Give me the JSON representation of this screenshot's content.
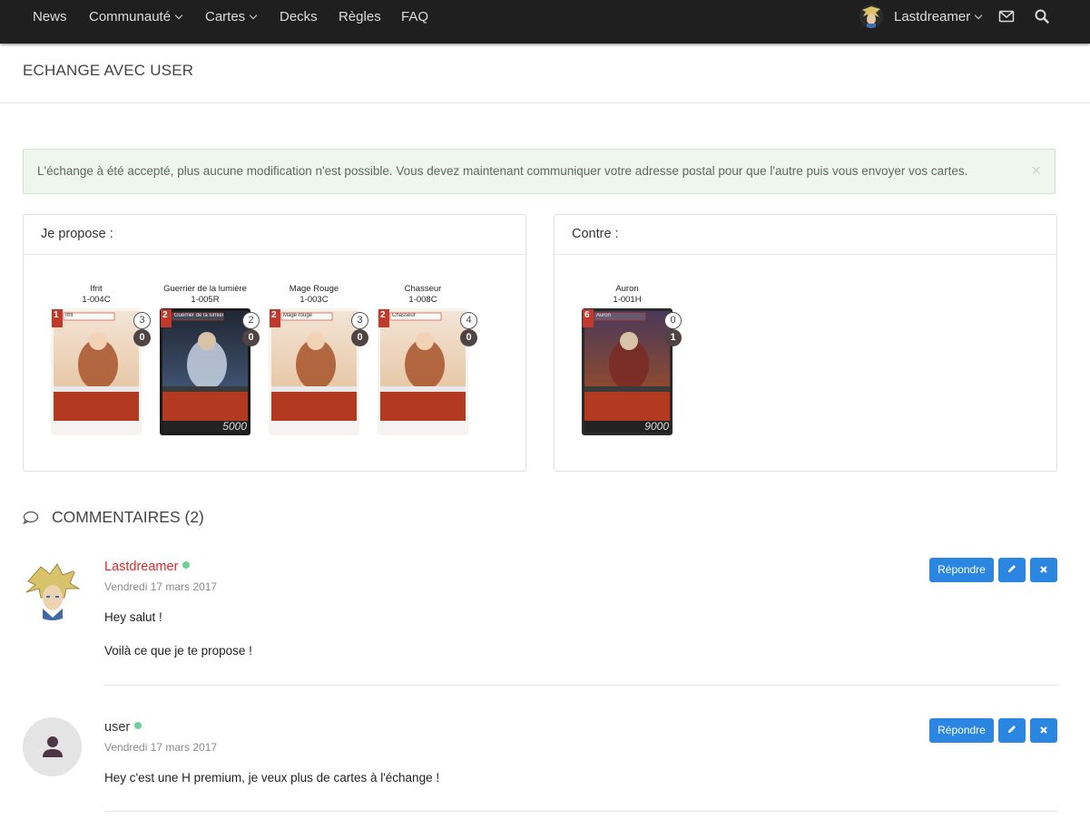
{
  "nav": {
    "items": [
      {
        "label": "News"
      },
      {
        "label": "Communauté"
      },
      {
        "label": "Cartes"
      },
      {
        "label": "Decks"
      },
      {
        "label": "Règles"
      },
      {
        "label": "FAQ"
      }
    ],
    "username": "Lastdreamer"
  },
  "page": {
    "title": "ECHANGE AVEC USER"
  },
  "alert": {
    "text": "L'échange à été accepté, plus aucune modification n'est possible. Vous devez maintenant communiquer votre adresse postal pour que l'autre puis vous envoyer vos cartes.",
    "close": "×"
  },
  "propose": {
    "title": "Je propose :",
    "cards": [
      {
        "name": "Ifrit",
        "code": "1-004C",
        "count": "3",
        "trade": "0",
        "cost": "1",
        "title_on_card": "Ifrit",
        "style": "light",
        "power": ""
      },
      {
        "name": "Guerrier de la lumière",
        "code": "1-005R",
        "count": "2",
        "trade": "0",
        "cost": "2",
        "title_on_card": "Guerrier de la lumière",
        "style": "dark",
        "power": "5000"
      },
      {
        "name": "Mage Rouge",
        "code": "1-003C",
        "count": "3",
        "trade": "0",
        "cost": "2",
        "title_on_card": "Mage rouge",
        "style": "light",
        "power": ""
      },
      {
        "name": "Chasseur",
        "code": "1-008C",
        "count": "4",
        "trade": "0",
        "cost": "2",
        "title_on_card": "Chasseur",
        "style": "light",
        "power": ""
      }
    ]
  },
  "contre": {
    "title": "Contre :",
    "cards": [
      {
        "name": "Auron",
        "code": "1-001H",
        "count": "0",
        "trade": "1",
        "cost": "6",
        "title_on_card": "Auron",
        "style": "mid",
        "power": "9000"
      }
    ]
  },
  "comments": {
    "title": "COMMENTAIRES (2)",
    "items": [
      {
        "author": "Lastdreamer",
        "author_color": "#e3262c",
        "date": "Vendredi 17 mars 2017",
        "lines": [
          "Hey salut !",
          "Voilà ce que je te propose !"
        ],
        "reply_label": "Répondre"
      },
      {
        "author": "user",
        "author_color": "#333333",
        "date": "Vendredi 17 mars 2017",
        "lines": [
          "Hey c'est une H premium, je veux plus de cartes à l'échange !"
        ],
        "reply_label": "Répondre"
      }
    ]
  },
  "colors": {
    "accent": "#2a86e0",
    "navbar": "#1f1f1f",
    "online": "#6fcf97",
    "card_red": "#c0392b"
  },
  "icons": {
    "mail": "envelope-icon",
    "search": "search-icon",
    "comment": "speech-bubble-icon",
    "edit": "pencil-icon",
    "delete": "close-icon"
  }
}
